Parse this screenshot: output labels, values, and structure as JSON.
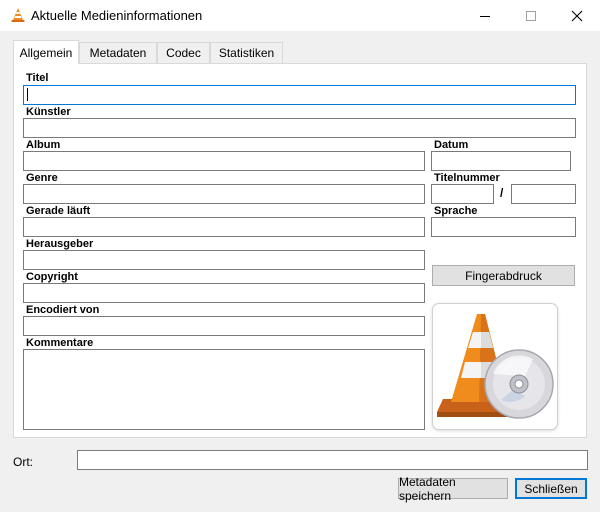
{
  "window": {
    "title": "Aktuelle Medieninformationen",
    "minimize_icon": "minimize-icon",
    "maximize_icon": "maximize-icon",
    "close_icon": "close-icon",
    "app_icon": "vlc-cone-icon"
  },
  "tabs": [
    {
      "label": "Allgemein",
      "active": true
    },
    {
      "label": "Metadaten",
      "active": false
    },
    {
      "label": "Codec",
      "active": false
    },
    {
      "label": "Statistiken",
      "active": false
    }
  ],
  "general": {
    "title_label": "Titel",
    "title_value": "",
    "artist_label": "Künstler",
    "artist_value": "",
    "album_label": "Album",
    "album_value": "",
    "date_label": "Datum",
    "date_value": "",
    "genre_label": "Genre",
    "genre_value": "",
    "track_label": "Titelnummer",
    "track_number_value": "",
    "track_separator": "/",
    "track_total_value": "",
    "now_playing_label": "Gerade läuft",
    "now_playing_value": "",
    "language_label": "Sprache",
    "language_value": "",
    "publisher_label": "Herausgeber",
    "publisher_value": "",
    "copyright_label": "Copyright",
    "copyright_value": "",
    "fingerprint_button": "Fingerabdruck",
    "encoded_by_label": "Encodiert von",
    "encoded_by_value": "",
    "comments_label": "Kommentare",
    "comments_value": "",
    "artwork_icon": "vlc-cone-disc-artwork"
  },
  "footer": {
    "location_label": "Ort:",
    "location_value": "",
    "save_button": "Metadaten speichern",
    "close_button": "Schließen"
  },
  "colors": {
    "accent": "#0078d7",
    "vlc_orange": "#f08c1e"
  }
}
